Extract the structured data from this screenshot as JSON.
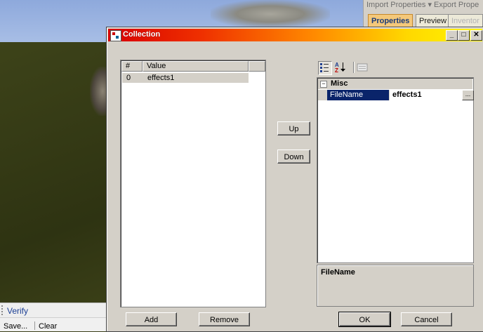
{
  "background": {
    "menu": {
      "import_label": "Import Properties",
      "export_label": "Export Prope"
    },
    "tabs": [
      {
        "label": "Properties"
      },
      {
        "label": "Preview"
      },
      {
        "label": "Inventor"
      }
    ],
    "verify_label": "Verify",
    "save_label": "Save...",
    "clear_label": "Clear"
  },
  "dialog": {
    "title": "Collection",
    "colors": {
      "title_start": "#d80000",
      "title_end": "#fff700",
      "selection": "#0a246a"
    },
    "members": {
      "columns": [
        "#",
        "Value"
      ],
      "rows": [
        {
          "index": "0",
          "value": "effects1"
        }
      ]
    },
    "up_label": "Up",
    "down_label": "Down",
    "add_label": "Add",
    "remove_label": "Remove",
    "properties": {
      "toolbar_icons": [
        "categorized-icon",
        "alphabetical-icon",
        "property-pages-icon"
      ],
      "category": "Misc",
      "rows": [
        {
          "name": "FileName",
          "value": "effects1",
          "button": "..."
        }
      ],
      "help_title": "FileName"
    },
    "ok_label": "OK",
    "cancel_label": "Cancel"
  }
}
